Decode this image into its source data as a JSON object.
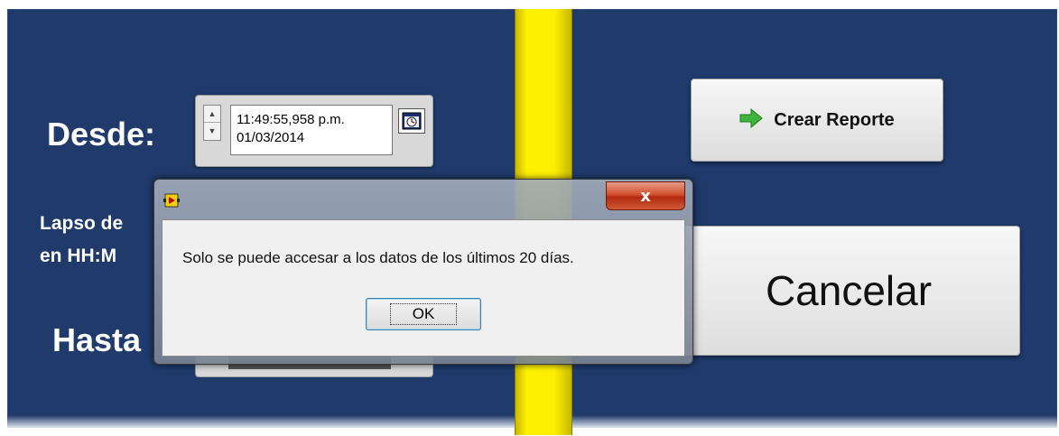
{
  "window": {
    "background_color": "#1f3a6b",
    "divider_color": "#ffee00"
  },
  "form": {
    "desde_label": "Desde:",
    "lapso_label_line1": "Lapso de",
    "lapso_label_line2": "en HH:M",
    "hasta_label": "Hasta",
    "desde_time": "11:49:55,958 p.m.",
    "desde_date": "01/03/2014",
    "calendar_icon": "calendar-clock-icon"
  },
  "buttons": {
    "crear_reporte_label": "Crear  Reporte",
    "crear_reporte_icon": "green-arrow-right-icon",
    "cancelar_label": "Cancelar"
  },
  "dialog": {
    "app_icon": "labview-icon",
    "close_label": "x",
    "message": "Solo se puede accesar a los datos de los últimos 20 días.",
    "ok_label": "OK",
    "close_button_color": "#d2502f"
  }
}
